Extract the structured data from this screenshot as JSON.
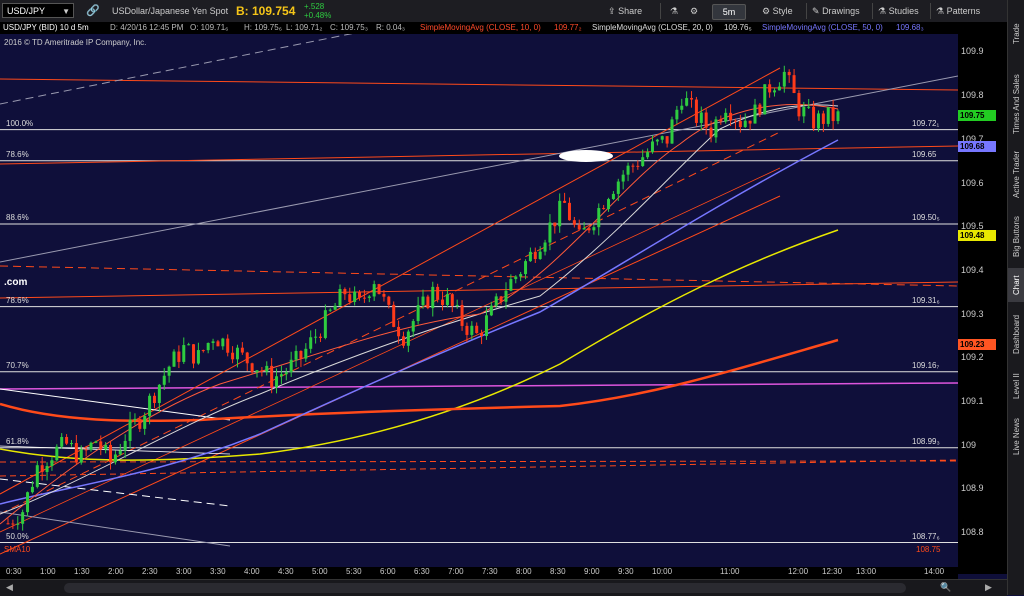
{
  "toolbar": {
    "symbol": "USD/JPY",
    "description": "USDollar/Japanese Yen Spot",
    "bid": "B: 109.754",
    "change_abs": "+.528",
    "change_pct": "+0.48%",
    "share_label": "Share",
    "timeframe": "5m",
    "style_label": "Style",
    "drawings_label": "Drawings",
    "studies_label": "Studies",
    "patterns_label": "Patterns"
  },
  "infobar": {
    "title": "USD/JPY (BID) 10 d 5m",
    "date": "D: 4/20/16 12:45 PM",
    "open": "O: 109.71₆",
    "high": "H: 109.75₆",
    "low": "L: 109.71₂",
    "close": "C: 109.75₃",
    "range": "R: 0.04₃",
    "sma10": "SimpleMovingAvg (CLOSE, 10, 0)",
    "sma10_val": "109.77₂",
    "sma20": "SimpleMovingAvg (CLOSE, 20, 0)",
    "sma20_val": "109.76₅",
    "sma50": "SimpleMovingAvg (CLOSE, 50, 0)",
    "sma50_val": "109.68₃"
  },
  "watermark": "2016 © TD Ameritrade IP Company, Inc.",
  "com_label": ".com",
  "sma_label": "SMA10",
  "fib_levels": [
    {
      "pct": "100.0%",
      "price": "109.72₁",
      "value": 109.721
    },
    {
      "pct": "78.6%",
      "price": "109.65",
      "value": 109.65
    },
    {
      "pct": "88.6%",
      "price": "109.50₅",
      "value": 109.505
    },
    {
      "pct": "78.6%",
      "price": "109.31₆",
      "value": 109.316
    },
    {
      "pct": "70.7%",
      "price": "109.16₇",
      "value": 109.167
    },
    {
      "pct": "61.8%",
      "price": "108.99₃",
      "value": 108.993
    },
    {
      "pct": "50.0%",
      "price": "108.77₆",
      "value": 108.776
    }
  ],
  "sma_bottom_price": "108.75",
  "y_axis": {
    "ticks": [
      "109.9",
      "109.8",
      "109.7",
      "109.6",
      "109.5",
      "109.4",
      "109.3",
      "109.2",
      "109.1",
      "109",
      "108.9",
      "108.8"
    ],
    "min": 108.72,
    "max": 109.94,
    "labels": [
      {
        "text": "109.75",
        "value": 109.754,
        "color": "#22cc22"
      },
      {
        "text": "109.68",
        "value": 109.683,
        "color": "#7777ff"
      },
      {
        "text": "109.48",
        "value": 109.48,
        "color": "#e8e800"
      },
      {
        "text": "109.23",
        "value": 109.23,
        "color": "#ff5522"
      }
    ]
  },
  "x_axis": {
    "ticks": [
      "0:30",
      "1:00",
      "1:30",
      "2:00",
      "2:30",
      "3:00",
      "3:30",
      "4:00",
      "4:30",
      "5:00",
      "5:30",
      "6:00",
      "6:30",
      "7:00",
      "7:30",
      "8:00",
      "8:30",
      "9:00",
      "9:30",
      "10:00",
      "11:00",
      "12:00",
      "12:30",
      "13:00",
      "14:00"
    ]
  },
  "sidebar_tabs": [
    "Trade",
    "Times And Sales",
    "Active Trader",
    "Big Buttons",
    "Chart",
    "Dashboard",
    "Level II",
    "Live News"
  ],
  "colors": {
    "background": "#0f0f3a",
    "up_candle": "#2ecc40",
    "down_candle": "#ff3a1a",
    "sma10": "#ff5a3a",
    "sma20": "#d9d9d9",
    "sma50": "#7777ff",
    "sma_yellow": "#e8e800",
    "sma_orange": "#ff4a1a",
    "magenta_line": "#dd55dd"
  },
  "chart_data": {
    "type": "candlestick",
    "symbol": "USD/JPY",
    "interval": "5m",
    "ylim": [
      108.72,
      109.94
    ],
    "series": [
      {
        "name": "SimpleMovingAvg (CLOSE, 10, 0)",
        "last": 109.772
      },
      {
        "name": "SimpleMovingAvg (CLOSE, 20, 0)",
        "last": 109.765
      },
      {
        "name": "SimpleMovingAvg (CLOSE, 50, 0)",
        "last": 109.683
      }
    ],
    "close_path": [
      108.82,
      108.85,
      108.95,
      108.98,
      109.0,
      108.97,
      109.01,
      108.96,
      109.02,
      109.06,
      109.12,
      109.18,
      109.22,
      109.2,
      109.25,
      109.23,
      109.2,
      109.18,
      109.15,
      109.17,
      109.2,
      109.25,
      109.3,
      109.35,
      109.32,
      109.38,
      109.3,
      109.25,
      109.3,
      109.35,
      109.33,
      109.28,
      109.25,
      109.3,
      109.36,
      109.4,
      109.45,
      109.5,
      109.55,
      109.47,
      109.52,
      109.58,
      109.62,
      109.65,
      109.68,
      109.7,
      109.8,
      109.75,
      109.72,
      109.78,
      109.74,
      109.76,
      109.82,
      109.85,
      109.77,
      109.74,
      109.75
    ]
  }
}
